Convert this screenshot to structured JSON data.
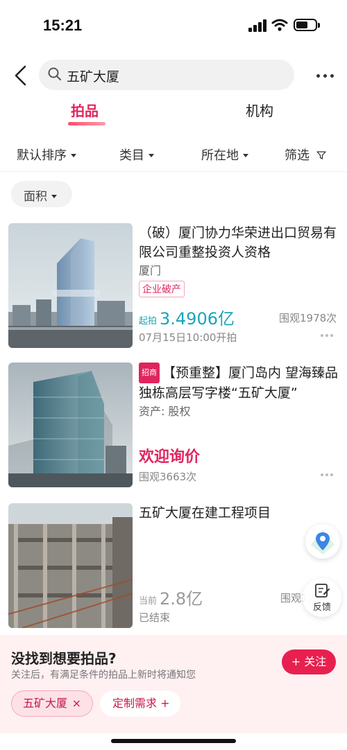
{
  "status": {
    "time": "15:21"
  },
  "search": {
    "query": "五矿大厦"
  },
  "tabs": [
    {
      "label": "拍品"
    },
    {
      "label": "机构"
    }
  ],
  "filters": [
    {
      "label": "默认排序"
    },
    {
      "label": "类目"
    },
    {
      "label": "所在地"
    },
    {
      "label": "筛选"
    }
  ],
  "chip": {
    "label": "面积"
  },
  "items": [
    {
      "title": "（破）厦门协力华荣进出口贸易有限公司重整投资人资格",
      "location": "厦门",
      "tag": "企业破产",
      "price_label": "起拍",
      "price": "3.4906亿",
      "views": "围观1978次",
      "time": "07月15日10:00开拍",
      "price_color": "#1aa5b8"
    },
    {
      "badge": "招商",
      "title": "【预重整】厦门岛内 望海臻品独栋高层写字楼“五矿大厦”",
      "asset": "资产: 股权",
      "price": "欢迎询价",
      "views": "围观3663次",
      "price_color": "#e0245e"
    },
    {
      "title": "五矿大厦在建工程项目",
      "price_label": "当前",
      "price": "2.8亿",
      "views": "围观12",
      "status": "已结束",
      "price_color": "#999999"
    }
  ],
  "feedback": {
    "label": "反馈"
  },
  "bottom": {
    "title": "没找到想要拍品?",
    "subtitle": "关注后，有满足条件的拍品上新时将通知您",
    "follow": "+ 关注",
    "keyword_chip": "五矿大厦",
    "keyword_close": "×",
    "custom_chip": "定制需求 +"
  },
  "colors": {
    "accent": "#e0245e",
    "teal_price": "#1aa5b8"
  }
}
